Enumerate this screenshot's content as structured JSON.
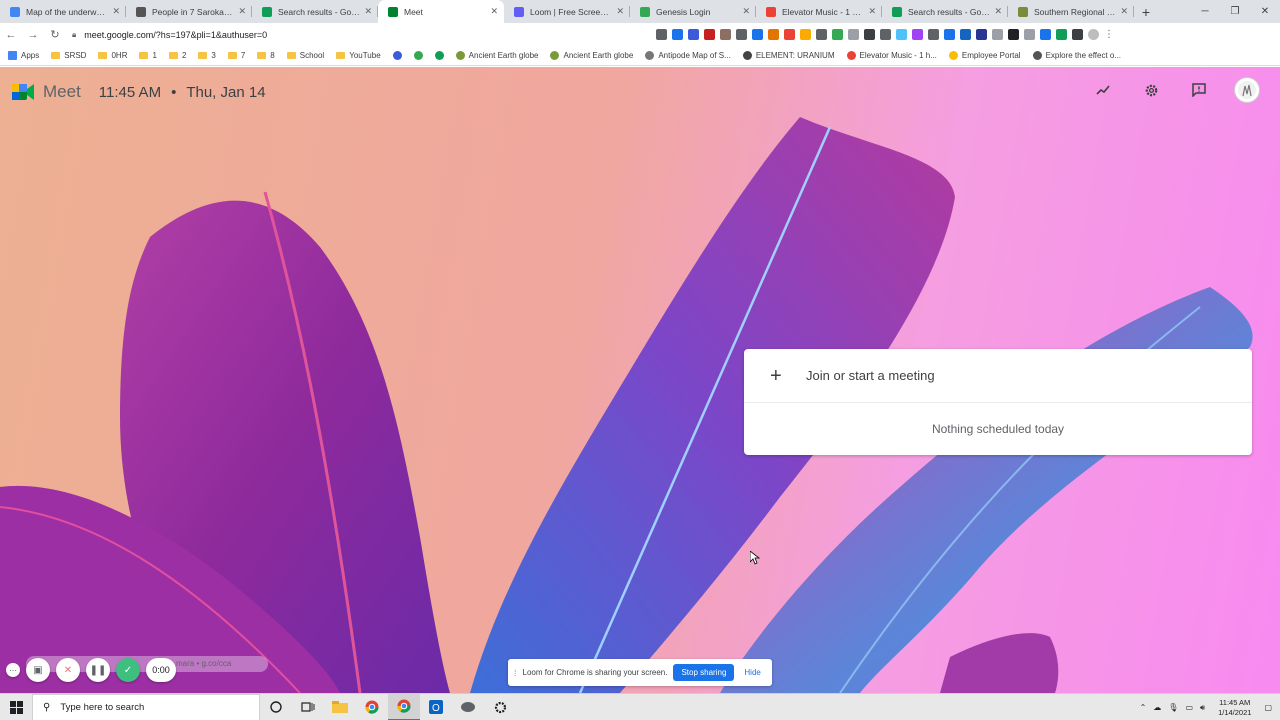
{
  "browser": {
    "tabs": [
      {
        "label": "Map of the underworld",
        "fav": "#4285f4"
      },
      {
        "label": "People in 7 Saroka Sci",
        "fav": "#555555"
      },
      {
        "label": "Search results - Google",
        "fav": "#0f9d58"
      },
      {
        "label": "Meet",
        "fav": "#00832d",
        "active": true
      },
      {
        "label": "Loom | Free Screen & V",
        "fav": "#625df5"
      },
      {
        "label": "Genesis Login",
        "fav": "#34a853"
      },
      {
        "label": "Elevator Music - 1 hour",
        "fav": "#ea4335"
      },
      {
        "label": "Search results - Google",
        "fav": "#0f9d58"
      },
      {
        "label": "Southern Regional Sch",
        "fav": "#7a8b3a"
      }
    ],
    "url": "meet.google.com/?hs=197&pli=1&authuser=0",
    "bookmarks": [
      {
        "label": "Apps",
        "type": "apps"
      },
      {
        "label": "SRSD",
        "type": "folder"
      },
      {
        "label": "0HR",
        "type": "folder"
      },
      {
        "label": "1",
        "type": "folder"
      },
      {
        "label": "2",
        "type": "folder"
      },
      {
        "label": "3",
        "type": "folder"
      },
      {
        "label": "7",
        "type": "folder"
      },
      {
        "label": "8",
        "type": "folder"
      },
      {
        "label": "School",
        "type": "folder"
      },
      {
        "label": "YouTube",
        "type": "folder"
      },
      {
        "label": "",
        "type": "dot",
        "color": "#3b5bdb"
      },
      {
        "label": "",
        "type": "dot",
        "color": "#34a853"
      },
      {
        "label": "",
        "type": "dot",
        "color": "#0f9d58"
      },
      {
        "label": "Ancient Earth globe",
        "type": "dot",
        "color": "#7a9a3a"
      },
      {
        "label": "Ancient Earth globe",
        "type": "dot",
        "color": "#7a9a3a"
      },
      {
        "label": "Antipode Map of S...",
        "type": "dot",
        "color": "#777777"
      },
      {
        "label": "ELEMENT: URANIUM",
        "type": "dot",
        "color": "#444444"
      },
      {
        "label": "Elevator Music - 1 h...",
        "type": "dot",
        "color": "#ea4335"
      },
      {
        "label": "Employee Portal",
        "type": "dot",
        "color": "#fbbc04"
      },
      {
        "label": "Explore the effect o...",
        "type": "dot",
        "color": "#555555"
      }
    ]
  },
  "meet": {
    "brand": "Meet",
    "time": "11:45 AM",
    "separator": "•",
    "date": "Thu, Jan 14",
    "join_label": "Join or start a meeting",
    "plus": "+",
    "empty_label": "Nothing scheduled today"
  },
  "loom": {
    "sharing_text": "Loom for Chrome is sharing your screen.",
    "stop_label": "Stop sharing",
    "hide_label": "Hide",
    "timer": "0:00",
    "caption": "mara • g.co/cca"
  },
  "taskbar": {
    "search_placeholder": "Type here to search",
    "time": "11:45 AM",
    "date": "1/14/2021"
  }
}
